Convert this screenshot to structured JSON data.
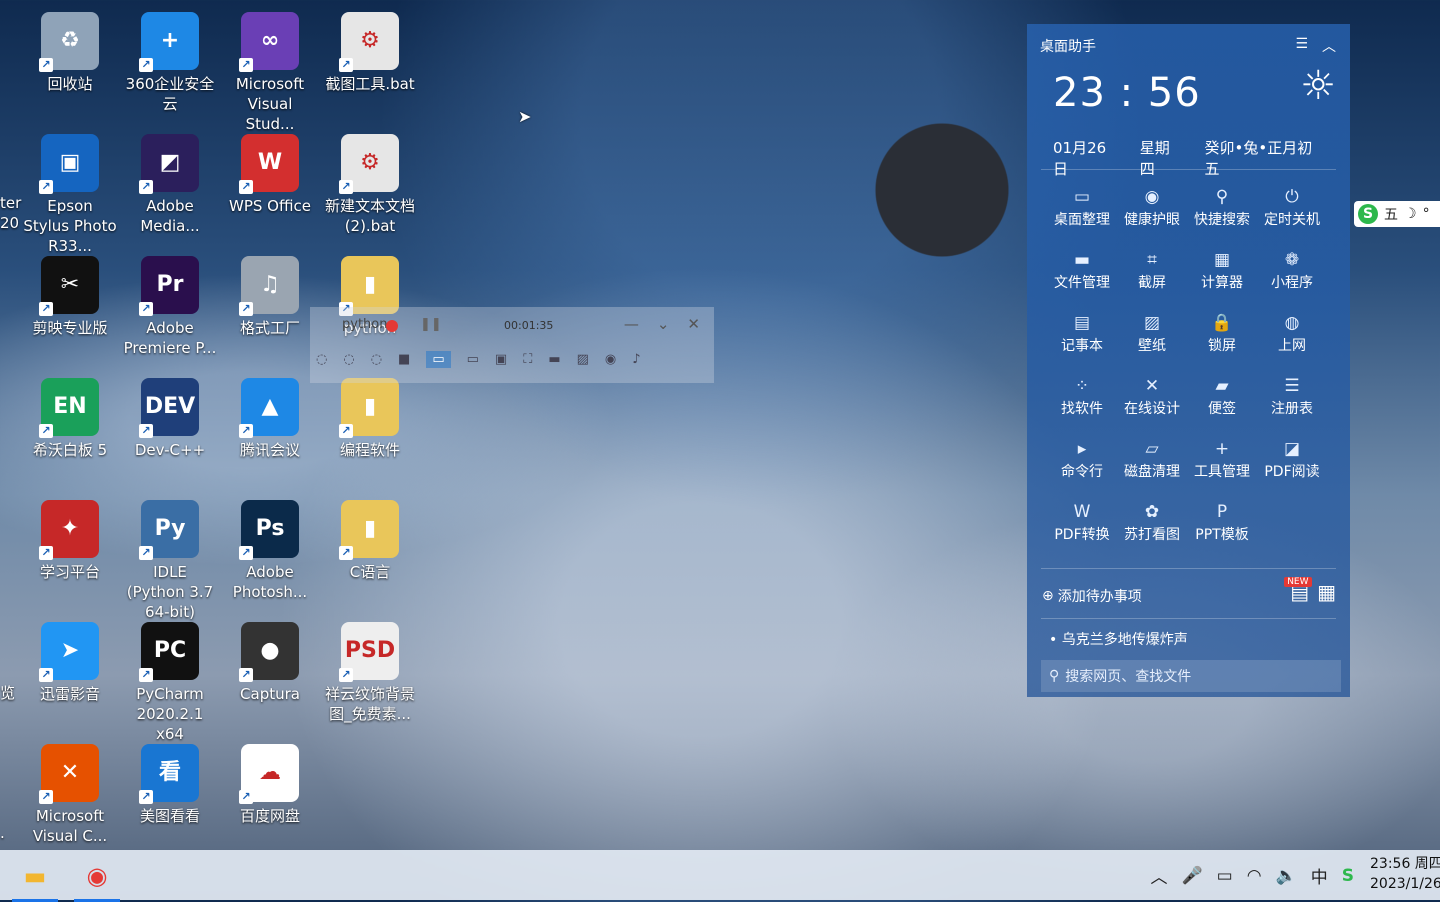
{
  "desktop": {
    "icons": [
      {
        "label": "回收站",
        "glyph": "♻",
        "bg": "#8fa3b8"
      },
      {
        "label": "360企业安全云",
        "glyph": "+",
        "bg": "#1e88e5"
      },
      {
        "label": "Microsoft Visual Stud...",
        "glyph": "∞",
        "bg": "#6a3fb5"
      },
      {
        "label": "截图工具.bat",
        "glyph": "⚙",
        "bg": "#e6e6e6"
      },
      {
        "label": "Epson Stylus Photo R33...",
        "glyph": "▣",
        "bg": "#1565c0"
      },
      {
        "label": "Adobe Media...",
        "glyph": "◩",
        "bg": "#2b1f5c"
      },
      {
        "label": "WPS Office",
        "glyph": "W",
        "bg": "#d32f2f"
      },
      {
        "label": "新建文本文档(2).bat",
        "glyph": "⚙",
        "bg": "#e6e6e6"
      },
      {
        "label": "剪映专业版",
        "glyph": "✂",
        "bg": "#111111"
      },
      {
        "label": "Adobe Premiere P...",
        "glyph": "Pr",
        "bg": "#2a0f4d"
      },
      {
        "label": "格式工厂",
        "glyph": "♫",
        "bg": "#9aa5b1"
      },
      {
        "label": "python",
        "glyph": "▮",
        "bg": "#e9c65a"
      },
      {
        "label": "希沃白板 5",
        "glyph": "EN",
        "bg": "#1aa05a"
      },
      {
        "label": "Dev-C++",
        "glyph": "DEV",
        "bg": "#1f3f7a"
      },
      {
        "label": "腾讯会议",
        "glyph": "▲",
        "bg": "#1e88e5"
      },
      {
        "label": "编程软件",
        "glyph": "▮",
        "bg": "#e9c65a"
      },
      {
        "label": "学习平台",
        "glyph": "✦",
        "bg": "#c62828"
      },
      {
        "label": "IDLE (Python 3.7 64-bit)",
        "glyph": "Py",
        "bg": "#3a6ea5"
      },
      {
        "label": "Adobe Photosh...",
        "glyph": "Ps",
        "bg": "#0b2a4a"
      },
      {
        "label": "C语言",
        "glyph": "▮",
        "bg": "#e9c65a"
      },
      {
        "label": "迅雷影音",
        "glyph": "➤",
        "bg": "#2196f3"
      },
      {
        "label": "PyCharm 2020.2.1 x64",
        "glyph": "PC",
        "bg": "#111111"
      },
      {
        "label": "Captura",
        "glyph": "●",
        "bg": "#333333"
      },
      {
        "label": "祥云纹饰背景图_免费素...",
        "glyph": "PSD",
        "bg": "#eeeeee"
      },
      {
        "label": "Microsoft Visual C...",
        "glyph": "✕",
        "bg": "#e65100"
      },
      {
        "label": "美图看看",
        "glyph": "看",
        "bg": "#1976d2"
      },
      {
        "label": "百度网盘",
        "glyph": "☁",
        "bg": "#ffffff"
      }
    ],
    "edge_labels": [
      "ter",
      "20",
      "览",
      "."
    ]
  },
  "helper": {
    "title": "桌面助手",
    "menu_icon": "hamburger-icon",
    "collapse_icon": "chevron-up-icon",
    "time": "23 : 56",
    "date": "01月26日",
    "weekday": "星期四",
    "lunar": "癸卯•兔•正月初五",
    "weather_icon": "sun-icon",
    "tools": [
      {
        "label": "桌面整理",
        "icon": "▭"
      },
      {
        "label": "健康护眼",
        "icon": "◉"
      },
      {
        "label": "快捷搜索",
        "icon": "⚲"
      },
      {
        "label": "定时关机",
        "icon": "⏻"
      },
      {
        "label": "文件管理",
        "icon": "▬"
      },
      {
        "label": "截屏",
        "icon": "⌗"
      },
      {
        "label": "计算器",
        "icon": "▦"
      },
      {
        "label": "小程序",
        "icon": "❁"
      },
      {
        "label": "记事本",
        "icon": "▤"
      },
      {
        "label": "壁纸",
        "icon": "▨"
      },
      {
        "label": "锁屏",
        "icon": "🔒"
      },
      {
        "label": "上网",
        "icon": "◍"
      },
      {
        "label": "找软件",
        "icon": "⁘"
      },
      {
        "label": "在线设计",
        "icon": "✕"
      },
      {
        "label": "便签",
        "icon": "▰"
      },
      {
        "label": "注册表",
        "icon": "☰"
      },
      {
        "label": "命令行",
        "icon": "▸"
      },
      {
        "label": "磁盘清理",
        "icon": "▱"
      },
      {
        "label": "工具管理",
        "icon": "+"
      },
      {
        "label": "PDF阅读",
        "icon": "◪"
      },
      {
        "label": "PDF转换",
        "icon": "W"
      },
      {
        "label": "苏打看图",
        "icon": "✿"
      },
      {
        "label": "PPT模板",
        "icon": "P"
      }
    ],
    "todo_label": "添加待办事项",
    "new_badge": "NEW",
    "news": "乌克兰多地传爆炸声",
    "search_placeholder": "搜索网页、查找文件"
  },
  "recorder": {
    "title": "python",
    "elapsed": "00:01:35"
  },
  "ime": {
    "mode_label": "五"
  },
  "taskbar": {
    "tray_ime": "中",
    "time": "23:56 周四",
    "date": "2023/1/26"
  }
}
